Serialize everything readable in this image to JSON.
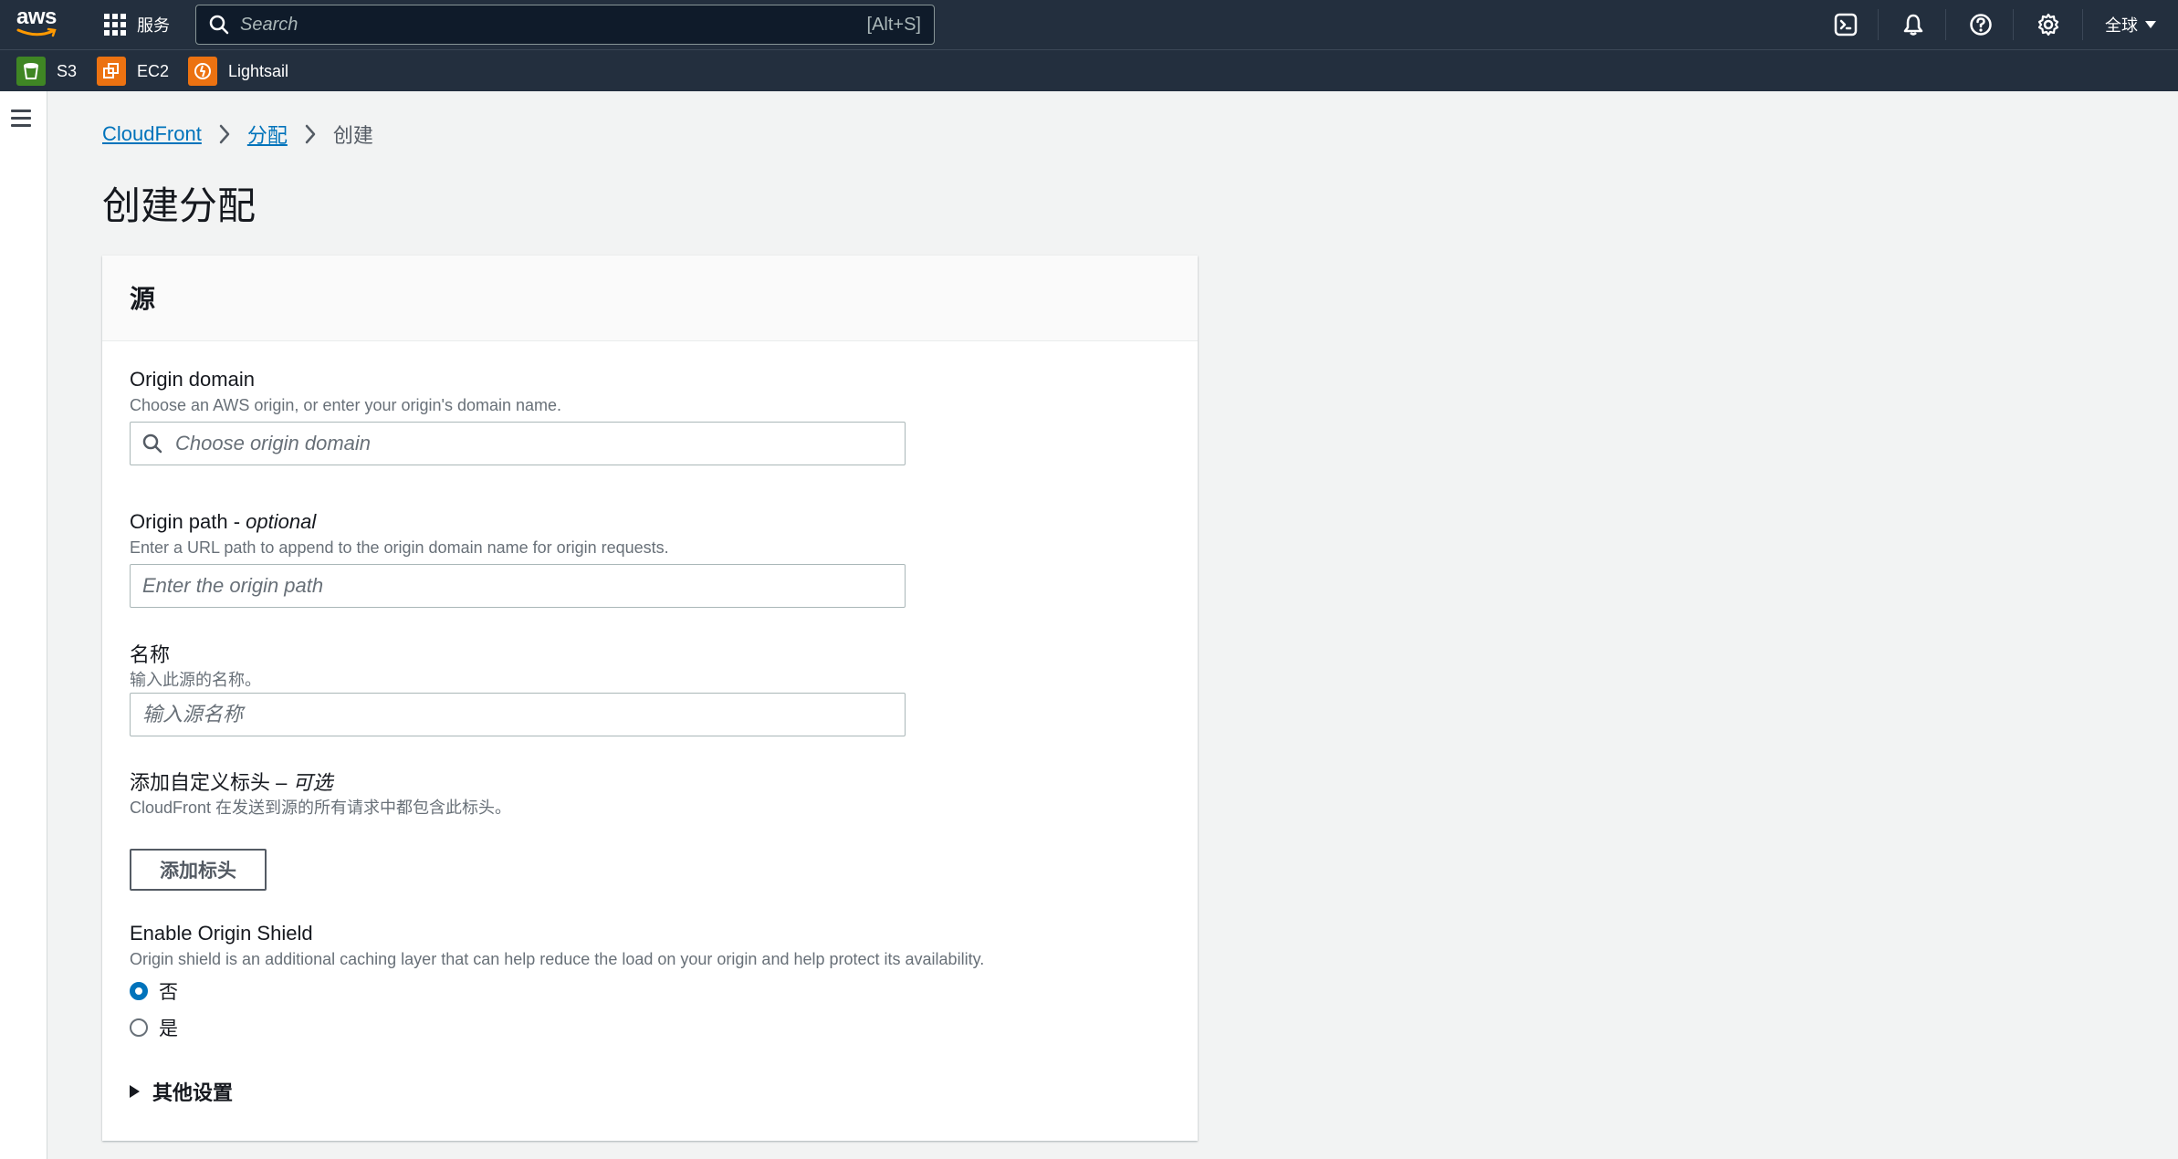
{
  "topnav": {
    "logo_text": "aws",
    "services_label": "服务",
    "search": {
      "placeholder": "Search",
      "shortcut": "[Alt+S]"
    },
    "icons": [
      "cloudshell-icon",
      "bell-icon",
      "help-icon",
      "gear-icon"
    ],
    "region_label": "全球"
  },
  "favorites": [
    {
      "label": "S3",
      "color": "#3f8624"
    },
    {
      "label": "EC2",
      "color": "#ec7211"
    },
    {
      "label": "Lightsail",
      "color": "#ec7211"
    }
  ],
  "breadcrumb": {
    "items": [
      "CloudFront",
      "分配"
    ],
    "current": "创建"
  },
  "page_title": "创建分配",
  "panel": {
    "header": "源",
    "origin_domain": {
      "label": "Origin domain",
      "description": "Choose an AWS origin, or enter your origin's domain name.",
      "placeholder": "Choose origin domain"
    },
    "origin_path": {
      "label": "Origin path - ",
      "label_optional": "optional",
      "description": "Enter a URL path to append to the origin domain name for origin requests.",
      "placeholder": "Enter the origin path"
    },
    "name": {
      "label": "名称",
      "description": "输入此源的名称。",
      "placeholder": "输入源名称"
    },
    "custom_headers": {
      "label": "添加自定义标头 – ",
      "label_optional": "可选",
      "description": "CloudFront 在发送到源的所有请求中都包含此标头。",
      "button": "添加标头"
    },
    "origin_shield": {
      "label": "Enable Origin Shield",
      "description": "Origin shield is an additional caching layer that can help reduce the load on your origin and help protect its availability.",
      "options": [
        {
          "label": "否",
          "checked": true
        },
        {
          "label": "是",
          "checked": false
        }
      ]
    },
    "additional_settings": "其他设置"
  },
  "colors": {
    "nav_bg": "#232f3e",
    "link": "#0073bb",
    "page_bg": "#f2f3f3"
  }
}
